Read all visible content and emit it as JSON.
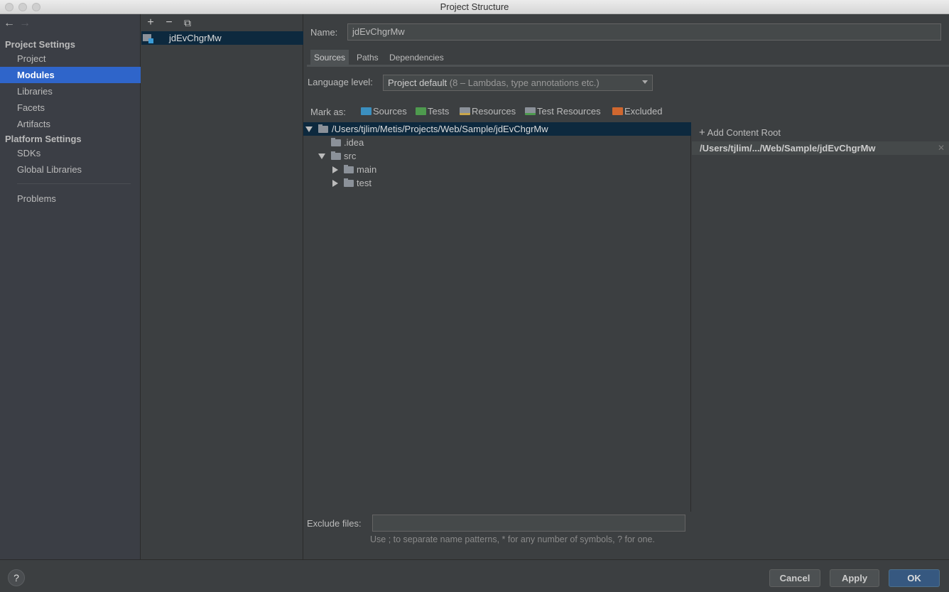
{
  "window": {
    "title": "Project Structure"
  },
  "sidebar": {
    "project_settings_header": "Project Settings",
    "platform_settings_header": "Platform Settings",
    "items": [
      {
        "label": "Project"
      },
      {
        "label": "Modules"
      },
      {
        "label": "Libraries"
      },
      {
        "label": "Facets"
      },
      {
        "label": "Artifacts"
      },
      {
        "label": "SDKs"
      },
      {
        "label": "Global Libraries"
      },
      {
        "label": "Problems"
      }
    ],
    "selected": "Modules"
  },
  "modules": {
    "toolbar": {
      "add": "+",
      "remove": "−",
      "copy": "⧉"
    },
    "items": [
      {
        "label": "jdEvChgrMw"
      }
    ]
  },
  "main": {
    "name_label": "Name:",
    "name_value": "jdEvChgrMw",
    "tabs": [
      {
        "label": "Sources"
      },
      {
        "label": "Paths"
      },
      {
        "label": "Dependencies"
      }
    ],
    "selected_tab": "Sources",
    "language_level_label": "Language level:",
    "language_level_value": "Project default",
    "language_level_hint": "(8 – Lambdas, type annotations etc.)",
    "mark_as_label": "Mark as:",
    "mark_as": [
      {
        "label": "Sources",
        "color": "#3b8fbf"
      },
      {
        "label": "Tests",
        "color": "#4e9a4e"
      },
      {
        "label": "Resources",
        "color": "#8b9199"
      },
      {
        "label": "Test Resources",
        "color": "#8b9199"
      },
      {
        "label": "Excluded",
        "color": "#d0672f"
      }
    ],
    "tree": [
      {
        "label": "/Users/tjlim/Metis/Projects/Web/Sample/jdEvChgrMw"
      },
      {
        "label": ".idea"
      },
      {
        "label": "src"
      },
      {
        "label": "main"
      },
      {
        "label": "test"
      }
    ],
    "add_content_root": "Add Content Root",
    "content_root": "/Users/tjlim/.../Web/Sample/jdEvChgrMw",
    "exclude_files_label": "Exclude files:",
    "exclude_files_value": "",
    "exclude_help": "Use ; to separate name patterns, * for any number of symbols, ? for one."
  },
  "footer": {
    "help": "?",
    "cancel": "Cancel",
    "apply": "Apply",
    "ok": "OK"
  }
}
